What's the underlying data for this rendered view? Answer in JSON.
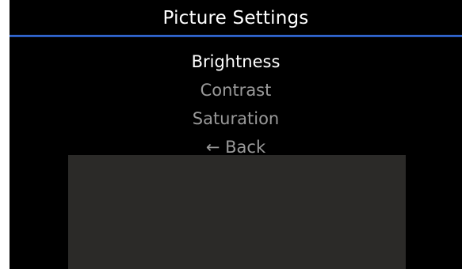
{
  "header": {
    "title": "Picture Settings"
  },
  "menu": {
    "items": [
      {
        "label": "Brightness",
        "state": "selected"
      },
      {
        "label": "Contrast",
        "state": "normal"
      },
      {
        "label": "Saturation",
        "state": "normal"
      },
      {
        "label": "← Back",
        "state": "normal"
      }
    ]
  },
  "colors": {
    "background": "#000000",
    "accent_line": "#2a5cc4",
    "selected_text": "#ffffff",
    "normal_text": "#9a9a9a",
    "preview_panel": "#2b2a28"
  }
}
